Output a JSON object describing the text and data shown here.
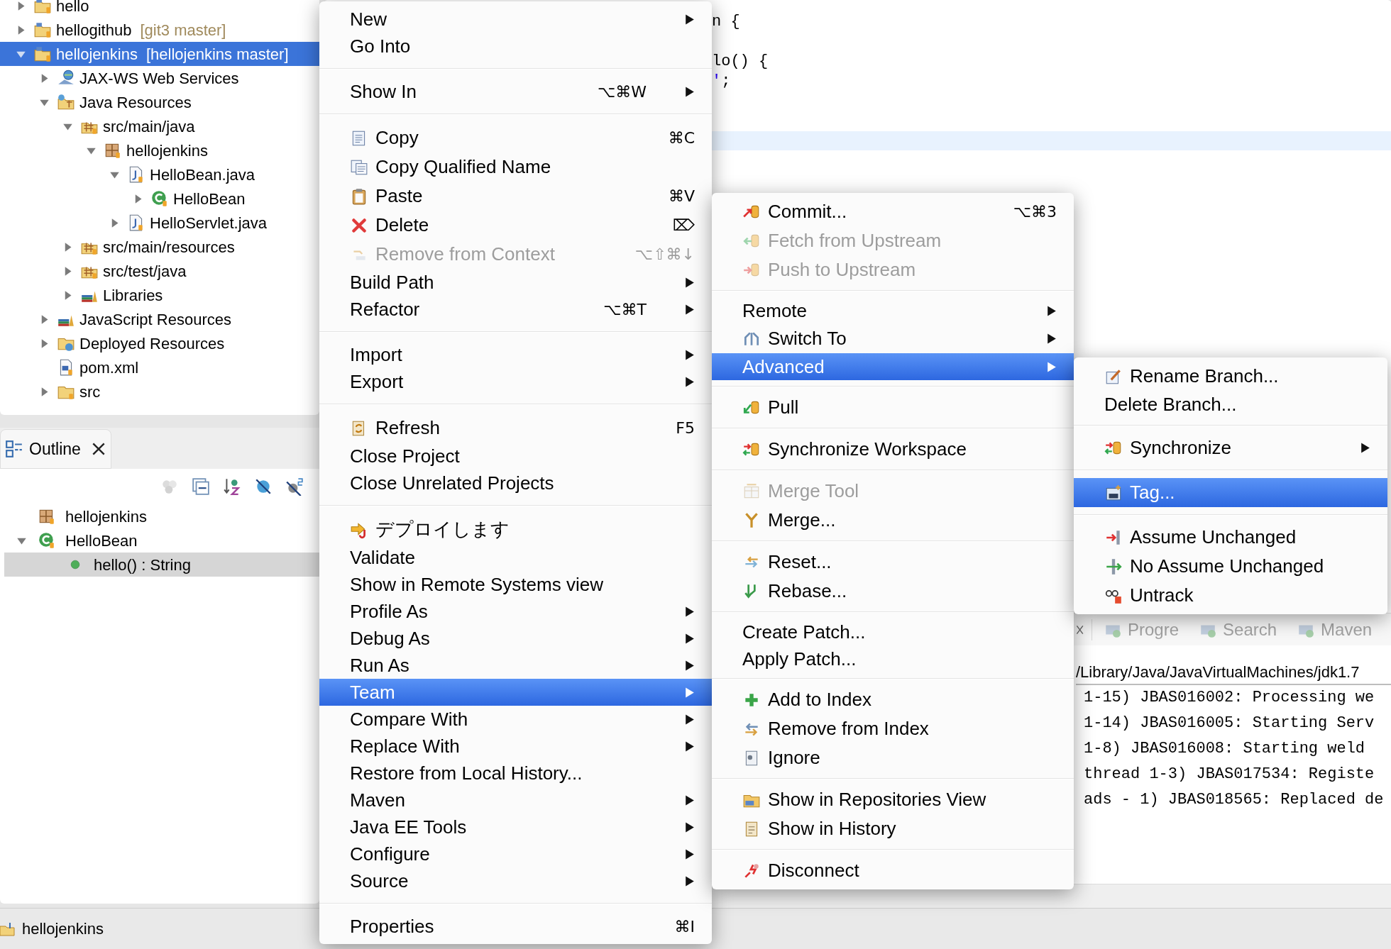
{
  "project_explorer": {
    "items": [
      {
        "label": "hello",
        "kind": "project",
        "expanded": false,
        "selected": false
      },
      {
        "label": "hellogithub",
        "tag": "[git3 master]",
        "kind": "project",
        "expanded": false,
        "selected": false
      },
      {
        "label": "hellojenkins",
        "tag": "[hellojenkins master]",
        "kind": "project",
        "expanded": true,
        "selected": true,
        "children": [
          {
            "label": "JAX-WS Web Services",
            "kind": "webservices",
            "expanded": false,
            "selected": false
          },
          {
            "label": "Java Resources",
            "kind": "java-resources",
            "expanded": true,
            "selected": false,
            "children": [
              {
                "label": "src/main/java",
                "kind": "source-folder",
                "expanded": true,
                "selected": false,
                "children": [
                  {
                    "label": "hellojenkins",
                    "kind": "package",
                    "expanded": true,
                    "selected": false,
                    "children": [
                      {
                        "label": "HelloBean.java",
                        "kind": "java-file",
                        "expanded": true,
                        "selected": false,
                        "children": [
                          {
                            "label": "HelloBean",
                            "kind": "class",
                            "expanded": false,
                            "selected": false
                          }
                        ]
                      },
                      {
                        "label": "HelloServlet.java",
                        "kind": "java-file",
                        "expanded": false,
                        "selected": false
                      }
                    ]
                  }
                ]
              },
              {
                "label": "src/main/resources",
                "kind": "source-folder",
                "expanded": false,
                "selected": false
              },
              {
                "label": "src/test/java",
                "kind": "source-folder",
                "expanded": false,
                "selected": false
              },
              {
                "label": "Libraries",
                "kind": "libraries",
                "expanded": false,
                "selected": false
              }
            ]
          },
          {
            "label": "JavaScript Resources",
            "kind": "libraries",
            "expanded": false,
            "selected": false
          },
          {
            "label": "Deployed Resources",
            "kind": "deployed",
            "expanded": false,
            "selected": false
          },
          {
            "label": "pom.xml",
            "kind": "xml-file",
            "selected": false
          },
          {
            "label": "src",
            "kind": "folder",
            "expanded": false,
            "selected": false
          }
        ]
      }
    ]
  },
  "outline": {
    "tab": "Outline",
    "items": [
      {
        "label": "hellojenkins",
        "kind": "package",
        "selected": false
      },
      {
        "label": "HelloBean",
        "kind": "class",
        "expanded": true,
        "selected": false,
        "children": [
          {
            "label": "hello() : String",
            "kind": "method",
            "selected": true
          }
        ]
      }
    ]
  },
  "editor": {
    "code_lines": [
      {
        "tokens": [
          {
            "text": "n {",
            "kind": "plain"
          }
        ]
      },
      {
        "tokens": [
          {
            "text": "lo() {",
            "kind": "plain"
          }
        ]
      },
      {
        "tokens": [
          {
            "text": "'",
            "kind": "string"
          },
          {
            "text": ";",
            "kind": "plain"
          }
        ]
      }
    ]
  },
  "console": {
    "tabs": [
      "Progre",
      "Search",
      "Maven"
    ],
    "path": "/Library/Java/JavaVirtualMachines/jdk1.7",
    "lines": [
      "1-15) JBAS016002: Processing we",
      "1-14) JBAS016005: Starting Serv",
      "1-8) JBAS016008: Starting weld",
      "thread 1-3) JBAS017534: Registe",
      "ads - 1) JBAS018565: Replaced de"
    ]
  },
  "context_menu": {
    "groups": [
      {
        "items": [
          {
            "label": "New",
            "kind": "plain",
            "submenu": true,
            "disabled": false,
            "selected": false
          },
          {
            "label": "Go Into",
            "kind": "plain",
            "submenu": false,
            "disabled": false,
            "selected": false
          }
        ]
      },
      {
        "items": [
          {
            "label": "Show In",
            "shortcut": "⌥⌘W",
            "kind": "plain",
            "submenu": true,
            "disabled": false,
            "selected": false
          }
        ]
      },
      {
        "items": [
          {
            "label": "Copy",
            "shortcut": "⌘C",
            "kind": "copy",
            "submenu": false,
            "disabled": false,
            "selected": false
          },
          {
            "label": "Copy Qualified Name",
            "kind": "copy-qualified",
            "submenu": false,
            "disabled": false,
            "selected": false
          },
          {
            "label": "Paste",
            "shortcut": "⌘V",
            "kind": "paste",
            "submenu": false,
            "disabled": false,
            "selected": false
          },
          {
            "label": "Delete",
            "shortcut": "⌦",
            "kind": "delete",
            "submenu": false,
            "disabled": false,
            "selected": false
          },
          {
            "label": "Remove from Context",
            "shortcut": "⌥⇧⌘↓",
            "kind": "remove-context",
            "submenu": false,
            "disabled": true,
            "selected": false
          },
          {
            "label": "Build Path",
            "kind": "plain",
            "submenu": true,
            "disabled": false,
            "selected": false
          },
          {
            "label": "Refactor",
            "shortcut": "⌥⌘T",
            "kind": "plain",
            "submenu": true,
            "disabled": false,
            "selected": false
          }
        ]
      },
      {
        "items": [
          {
            "label": "Import",
            "kind": "plain",
            "submenu": true,
            "disabled": false,
            "selected": false
          },
          {
            "label": "Export",
            "kind": "plain",
            "submenu": true,
            "disabled": false,
            "selected": false
          }
        ]
      },
      {
        "items": [
          {
            "label": "Refresh",
            "shortcut": "F5",
            "kind": "refresh",
            "submenu": false,
            "disabled": false,
            "selected": false
          },
          {
            "label": "Close Project",
            "kind": "plain",
            "submenu": false,
            "disabled": false,
            "selected": false
          },
          {
            "label": "Close Unrelated Projects",
            "kind": "plain",
            "submenu": false,
            "disabled": false,
            "selected": false
          }
        ]
      },
      {
        "items": [
          {
            "label": "デプロイします",
            "kind": "deploy",
            "submenu": false,
            "disabled": false,
            "selected": false
          },
          {
            "label": "Validate",
            "kind": "plain",
            "submenu": false,
            "disabled": false,
            "selected": false
          },
          {
            "label": "Show in Remote Systems view",
            "kind": "plain",
            "submenu": false,
            "disabled": false,
            "selected": false
          },
          {
            "label": "Profile As",
            "kind": "plain",
            "submenu": true,
            "disabled": false,
            "selected": false
          },
          {
            "label": "Debug As",
            "kind": "plain",
            "submenu": true,
            "disabled": false,
            "selected": false
          },
          {
            "label": "Run As",
            "kind": "plain",
            "submenu": true,
            "disabled": false,
            "selected": false
          },
          {
            "label": "Team",
            "kind": "plain",
            "submenu": true,
            "disabled": false,
            "selected": true
          },
          {
            "label": "Compare With",
            "kind": "plain",
            "submenu": true,
            "disabled": false,
            "selected": false
          },
          {
            "label": "Replace With",
            "kind": "plain",
            "submenu": true,
            "disabled": false,
            "selected": false
          },
          {
            "label": "Restore from Local History...",
            "kind": "plain",
            "submenu": false,
            "disabled": false,
            "selected": false
          },
          {
            "label": "Maven",
            "kind": "plain",
            "submenu": true,
            "disabled": false,
            "selected": false
          },
          {
            "label": "Java EE Tools",
            "kind": "plain",
            "submenu": true,
            "disabled": false,
            "selected": false
          },
          {
            "label": "Configure",
            "kind": "plain",
            "submenu": true,
            "disabled": false,
            "selected": false
          },
          {
            "label": "Source",
            "kind": "plain",
            "submenu": true,
            "disabled": false,
            "selected": false
          }
        ]
      },
      {
        "items": [
          {
            "label": "Properties",
            "shortcut": "⌘I",
            "kind": "plain",
            "submenu": false,
            "disabled": false,
            "selected": false
          }
        ]
      }
    ]
  },
  "team_menu": {
    "groups": [
      {
        "items": [
          {
            "label": "Commit...",
            "shortcut": "⌥⌘3",
            "kind": "commit",
            "submenu": false,
            "disabled": false,
            "selected": false
          },
          {
            "label": "Fetch from Upstream",
            "kind": "fetch",
            "submenu": false,
            "disabled": true,
            "selected": false
          },
          {
            "label": "Push to Upstream",
            "kind": "push",
            "submenu": false,
            "disabled": true,
            "selected": false
          }
        ]
      },
      {
        "items": [
          {
            "label": "Remote",
            "kind": "plain",
            "submenu": true,
            "disabled": false,
            "selected": false
          },
          {
            "label": "Switch To",
            "kind": "switch",
            "submenu": true,
            "disabled": false,
            "selected": false
          },
          {
            "label": "Advanced",
            "kind": "plain",
            "submenu": true,
            "disabled": false,
            "selected": true
          }
        ]
      },
      {
        "items": [
          {
            "label": "Pull",
            "kind": "pull",
            "submenu": false,
            "disabled": false,
            "selected": false
          }
        ]
      },
      {
        "items": [
          {
            "label": "Synchronize Workspace",
            "kind": "sync",
            "submenu": false,
            "disabled": false,
            "selected": false
          }
        ]
      },
      {
        "items": [
          {
            "label": "Merge Tool",
            "kind": "merge-tool",
            "submenu": false,
            "disabled": true,
            "selected": false
          },
          {
            "label": "Merge...",
            "kind": "merge",
            "submenu": false,
            "disabled": false,
            "selected": false
          }
        ]
      },
      {
        "items": [
          {
            "label": "Reset...",
            "kind": "reset",
            "submenu": false,
            "disabled": false,
            "selected": false
          },
          {
            "label": "Rebase...",
            "kind": "rebase",
            "submenu": false,
            "disabled": false,
            "selected": false
          }
        ]
      },
      {
        "items": [
          {
            "label": "Create Patch...",
            "kind": "plain",
            "submenu": false,
            "disabled": false,
            "selected": false
          },
          {
            "label": "Apply Patch...",
            "kind": "plain",
            "submenu": false,
            "disabled": false,
            "selected": false
          }
        ]
      },
      {
        "items": [
          {
            "label": "Add to Index",
            "kind": "add-index",
            "submenu": false,
            "disabled": false,
            "selected": false
          },
          {
            "label": "Remove from Index",
            "kind": "remove-index",
            "submenu": false,
            "disabled": false,
            "selected": false
          },
          {
            "label": "Ignore",
            "kind": "ignore",
            "submenu": false,
            "disabled": false,
            "selected": false
          }
        ]
      },
      {
        "items": [
          {
            "label": "Show in Repositories View",
            "kind": "repositories",
            "submenu": false,
            "disabled": false,
            "selected": false
          },
          {
            "label": "Show in History",
            "kind": "history",
            "submenu": false,
            "disabled": false,
            "selected": false
          }
        ]
      },
      {
        "items": [
          {
            "label": "Disconnect",
            "kind": "disconnect",
            "submenu": false,
            "disabled": false,
            "selected": false
          }
        ]
      }
    ]
  },
  "advanced_menu": {
    "groups": [
      {
        "items": [
          {
            "label": "Rename Branch...",
            "kind": "rename",
            "submenu": false,
            "disabled": false,
            "selected": false
          },
          {
            "label": "Delete Branch...",
            "kind": "plain",
            "submenu": false,
            "disabled": false,
            "selected": false
          }
        ]
      },
      {
        "items": [
          {
            "label": "Synchronize",
            "kind": "sync",
            "submenu": true,
            "disabled": false,
            "selected": false
          }
        ]
      },
      {
        "items": [
          {
            "label": "Tag...",
            "kind": "tag",
            "submenu": false,
            "disabled": false,
            "selected": true
          }
        ]
      },
      {
        "items": [
          {
            "label": "Assume Unchanged",
            "kind": "assume",
            "submenu": false,
            "disabled": false,
            "selected": false
          },
          {
            "label": "No Assume Unchanged",
            "kind": "no-assume",
            "submenu": false,
            "disabled": false,
            "selected": false
          },
          {
            "label": "Untrack",
            "kind": "untrack",
            "submenu": false,
            "disabled": false,
            "selected": false
          }
        ]
      }
    ]
  },
  "status_bar": {
    "label": "hellojenkins"
  }
}
